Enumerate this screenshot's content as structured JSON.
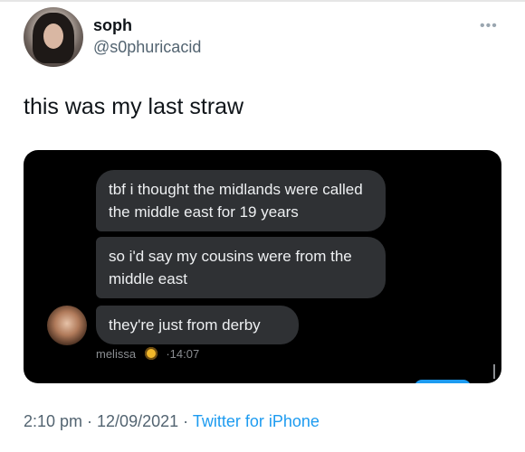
{
  "tweet": {
    "author_name": "soph",
    "author_handle": "@s0phuricacid",
    "more_icon": "more-horizontal-icon",
    "text": "this was my last straw",
    "timestamp": "2:10 pm · 12/09/2021 ·",
    "source": "Twitter for iPhone"
  },
  "chat_screenshot": {
    "messages": [
      "tbf i thought the midlands were called the middle east for 19 years",
      "so i'd say my cousins were from the middle east",
      "they're just from derby"
    ],
    "sender": "melissa",
    "sender_emoji_icon": "sunflower-icon",
    "time": "·14:07"
  },
  "colors": {
    "link": "#1d9bf0",
    "muted": "#536471",
    "chat_bg": "#000000",
    "bubble": "#2f3134"
  }
}
